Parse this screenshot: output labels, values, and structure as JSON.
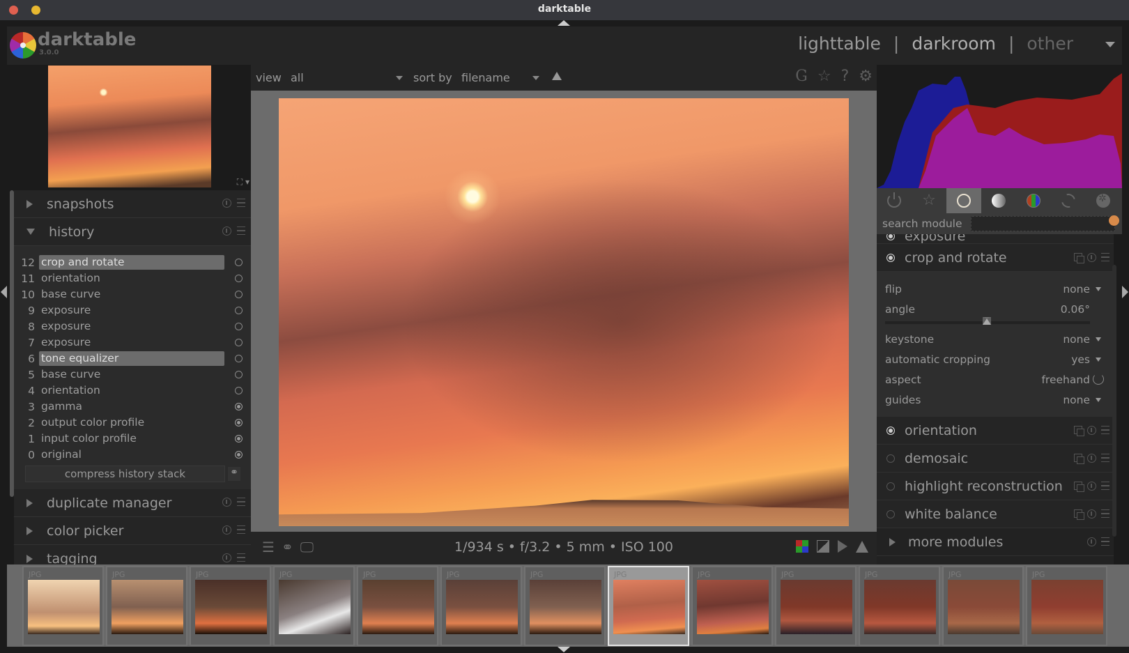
{
  "window": {
    "title": "darktable"
  },
  "header": {
    "app_name": "darktable",
    "version": "3.0.0",
    "views": [
      {
        "label": "lighttable",
        "state": "normal"
      },
      {
        "label": "darkroom",
        "state": "active"
      },
      {
        "label": "other",
        "state": "dim"
      }
    ],
    "separator": "|"
  },
  "toolbar": {
    "view_label": "view",
    "view_value": "all",
    "sort_label": "sort by",
    "sort_value": "filename",
    "icons": [
      "grouping-G",
      "star-icon",
      "help-icon",
      "gear-icon"
    ],
    "grouping_glyph": "G",
    "star_glyph": "☆",
    "help_glyph": "?",
    "gear_glyph": "⚙"
  },
  "left_panel": {
    "modules_top": [
      {
        "name": "snapshots",
        "expanded": false
      },
      {
        "name": "history",
        "expanded": true
      }
    ],
    "history": [
      {
        "num": "12",
        "label": "crop and rotate",
        "selected": true,
        "status": "on"
      },
      {
        "num": "11",
        "label": "orientation",
        "selected": false,
        "status": "on"
      },
      {
        "num": "10",
        "label": "base curve",
        "selected": false,
        "status": "on"
      },
      {
        "num": "9",
        "label": "exposure",
        "selected": false,
        "status": "on"
      },
      {
        "num": "8",
        "label": "exposure",
        "selected": false,
        "status": "on"
      },
      {
        "num": "7",
        "label": "exposure",
        "selected": false,
        "status": "on"
      },
      {
        "num": "6",
        "label": "tone equalizer",
        "selected": true,
        "status": "on"
      },
      {
        "num": "5",
        "label": "base curve",
        "selected": false,
        "status": "on"
      },
      {
        "num": "4",
        "label": "orientation",
        "selected": false,
        "status": "on"
      },
      {
        "num": "3",
        "label": "gamma",
        "selected": false,
        "status": "always-on"
      },
      {
        "num": "2",
        "label": "output color profile",
        "selected": false,
        "status": "always-on"
      },
      {
        "num": "1",
        "label": "input color profile",
        "selected": false,
        "status": "always-on"
      },
      {
        "num": "0",
        "label": "original",
        "selected": false,
        "status": "always-on"
      }
    ],
    "compress_button": "compress history stack",
    "modules_bottom": [
      {
        "name": "duplicate manager",
        "expanded": false
      },
      {
        "name": "color picker",
        "expanded": false
      },
      {
        "name": "tagging",
        "expanded": false
      }
    ]
  },
  "image_info": {
    "exif": "1/934 s • f/3.2 • 5 mm • ISO 100"
  },
  "bottom_left_icons": [
    "menu-icon",
    "style-icon",
    "display-profile-icon"
  ],
  "bottom_right_icons": [
    "softproof-icon",
    "gamut-check-icon",
    "overexposed-icon",
    "warning-icon"
  ],
  "right_panel": {
    "module_groups": [
      {
        "name": "active modules",
        "icon": "power-icon",
        "active": false
      },
      {
        "name": "favorites",
        "icon": "star-icon",
        "active": false
      },
      {
        "name": "basic",
        "icon": "circle-icon",
        "active": true
      },
      {
        "name": "tone",
        "icon": "tone-icon",
        "active": false
      },
      {
        "name": "color",
        "icon": "color-icon",
        "active": false
      },
      {
        "name": "correct",
        "icon": "correct-icon",
        "active": false
      },
      {
        "name": "effect",
        "icon": "effect-icon",
        "active": false
      }
    ],
    "search_label": "search module",
    "search_value": "",
    "partial_module": "exposure",
    "crop_module": {
      "name": "crop and rotate",
      "enabled": true,
      "params": [
        {
          "key": "flip",
          "value": "none",
          "control": "dropdown"
        },
        {
          "key": "angle",
          "value": "0.06°",
          "control": "slider",
          "slider_fraction": 0.5
        },
        {
          "key": "keystone",
          "value": "none",
          "control": "dropdown"
        },
        {
          "key": "automatic cropping",
          "value": "yes",
          "control": "dropdown"
        },
        {
          "key": "aspect",
          "value": "freehand",
          "control": "rotate"
        },
        {
          "key": "guides",
          "value": "none",
          "control": "dropdown"
        }
      ]
    },
    "modules": [
      {
        "name": "orientation",
        "enabled": true
      },
      {
        "name": "demosaic",
        "enabled": false
      },
      {
        "name": "highlight reconstruction",
        "enabled": false
      },
      {
        "name": "white balance",
        "enabled": false
      }
    ],
    "more_modules": "more modules"
  },
  "histogram": {
    "colors": {
      "red": "#9a1c1c",
      "blue": "#1c1c96",
      "magenta": "#9c1c9c"
    }
  },
  "filmstrip": {
    "selected_index": 7,
    "items": [
      {
        "ext": "JPG",
        "tone": "light"
      },
      {
        "ext": "JPG",
        "tone": "palm"
      },
      {
        "ext": "JPG",
        "tone": "dark-palm"
      },
      {
        "ext": "JPG",
        "tone": "grey-sky"
      },
      {
        "ext": "JPG",
        "tone": "palm-people"
      },
      {
        "ext": "JPG",
        "tone": "man"
      },
      {
        "ext": "JPG",
        "tone": "person"
      },
      {
        "ext": "JPG",
        "tone": "current"
      },
      {
        "ext": "JPG",
        "tone": "sun"
      },
      {
        "ext": "JPG",
        "tone": "buildings"
      },
      {
        "ext": "JPG",
        "tone": "buildings2"
      },
      {
        "ext": "JPG",
        "tone": "man-buildings"
      },
      {
        "ext": "JPG",
        "tone": "man2"
      }
    ]
  }
}
